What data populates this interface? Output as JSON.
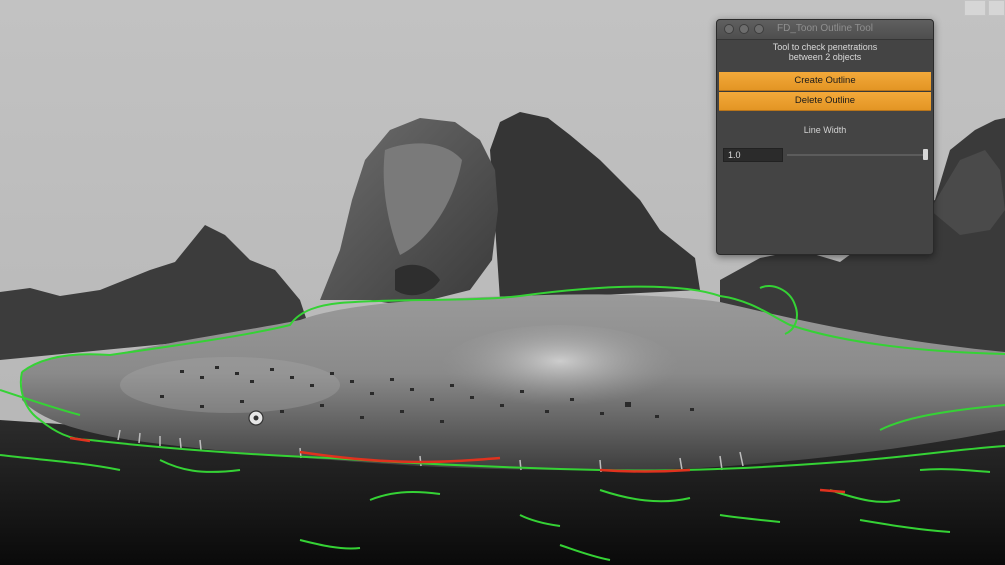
{
  "window": {
    "title": "FD_Toon Outline Tool",
    "description": [
      "Tool to check penetrations",
      "between 2 objects"
    ],
    "create_label": "Create Outline",
    "delete_label": "Delete Outline",
    "line_width_label": "Line Width",
    "line_width_value": "1.0",
    "line_width_slider_fraction": 1.0
  },
  "colors": {
    "viewport_background": "#b9b9b9",
    "outline": "#35d235",
    "penetration": "#e0321e",
    "button": "#eea032"
  },
  "icons": [
    "window-close-icon",
    "window-minimize-icon",
    "window-zoom-icon",
    "viewport-corner-icon"
  ]
}
